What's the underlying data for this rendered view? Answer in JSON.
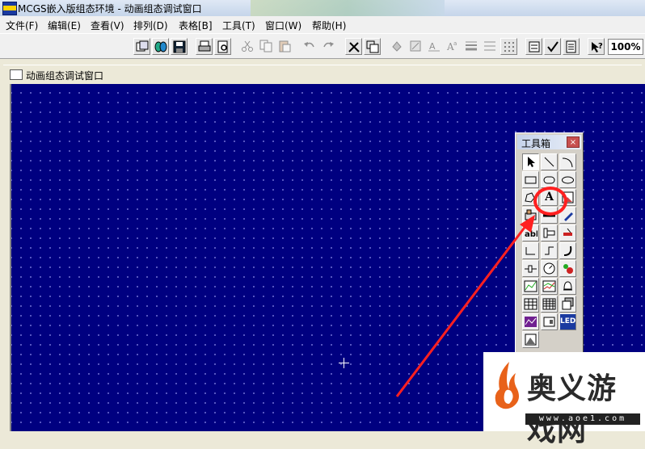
{
  "window": {
    "title": "MCGS嵌入版组态环境 - 动画组态调试窗口"
  },
  "menu": [
    "文件(F)",
    "编辑(E)",
    "查看(V)",
    "排列(D)",
    "表格[B]",
    "工具(T)",
    "窗口(W)",
    "帮助(H)"
  ],
  "toolbar": {
    "zoom": "100%"
  },
  "child_window": {
    "title": "动画组态调试窗口"
  },
  "toolbox": {
    "title": "工具箱",
    "close": "×",
    "text_tool_label": "A",
    "led_label": "LED"
  },
  "annotation": {
    "color": "#ff2020"
  },
  "watermark": {
    "text": "奥义游戏网",
    "url": "www.aoe1.com"
  },
  "colors": {
    "canvas": "#000080",
    "grid_dot": "#6c6cd0"
  }
}
